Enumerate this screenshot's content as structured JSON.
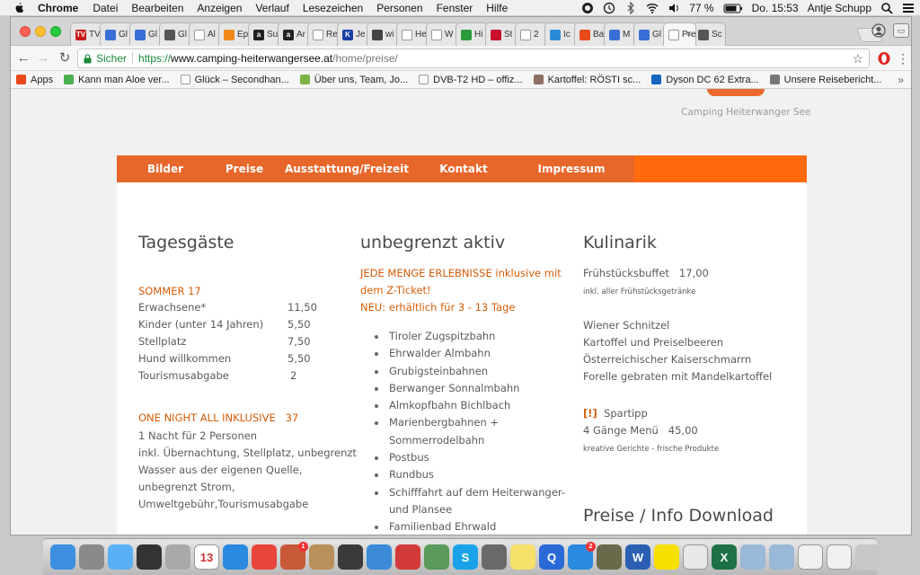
{
  "menubar": {
    "app_name": "Chrome",
    "items": [
      "Datei",
      "Bearbeiten",
      "Anzeigen",
      "Verlauf",
      "Lesezeichen",
      "Personen",
      "Fenster",
      "Hilfe"
    ],
    "battery": "77 %",
    "clock": "Do. 15:53",
    "user": "Antje Schupp"
  },
  "tabs": [
    {
      "label": "TV",
      "color": "#c61c1c",
      "glyph": "TV"
    },
    {
      "label": "Gl",
      "color": "#3a6fd8",
      "glyph": ""
    },
    {
      "label": "Gl",
      "color": "#3a6fd8",
      "glyph": ""
    },
    {
      "label": "Gl",
      "color": "#555555",
      "glyph": ""
    },
    {
      "label": "Al",
      "color": "#ffffff",
      "glyph": ""
    },
    {
      "label": "Ep",
      "color": "#f08a1c",
      "glyph": ""
    },
    {
      "label": "Su",
      "color": "#222222",
      "glyph": "a"
    },
    {
      "label": "Ar",
      "color": "#222222",
      "glyph": "a"
    },
    {
      "label": "Re",
      "color": "#ffffff",
      "glyph": ""
    },
    {
      "label": "Je",
      "color": "#1a3fa6",
      "glyph": "K"
    },
    {
      "label": "wi",
      "color": "#444444",
      "glyph": ""
    },
    {
      "label": "He",
      "color": "#ffffff",
      "glyph": ""
    },
    {
      "label": "W",
      "color": "#ffffff",
      "glyph": ""
    },
    {
      "label": "Hi",
      "color": "#2a9a3a",
      "glyph": ""
    },
    {
      "label": "St",
      "color": "#c8102e",
      "glyph": ""
    },
    {
      "label": "2",
      "color": "#ffffff",
      "glyph": ""
    },
    {
      "label": "Ic",
      "color": "#2a8bd8",
      "glyph": ""
    },
    {
      "label": "Ba",
      "color": "#e84a1c",
      "glyph": ""
    },
    {
      "label": "M",
      "color": "#3a6fd8",
      "glyph": ""
    },
    {
      "label": "Gl",
      "color": "#3a6fd8",
      "glyph": ""
    },
    {
      "label": "Pre",
      "color": "#ffffff",
      "glyph": "",
      "active": true
    },
    {
      "label": "Sc",
      "color": "#555555",
      "glyph": ""
    }
  ],
  "toolbar": {
    "secure_label": "Sicher",
    "url_scheme": "https://",
    "url_host": "www.camping-heiterwangersee.at",
    "url_path": "/home/preise/"
  },
  "bookmarks": [
    {
      "label": "Apps",
      "icon": "apps-icon",
      "color": "#e84a1c"
    },
    {
      "label": "Kann man Aloe ver...",
      "icon": "leaf-icon",
      "color": "#4caf50"
    },
    {
      "label": "Glück – Secondhan...",
      "icon": "page-icon",
      "color": "#ffffff"
    },
    {
      "label": "Über uns, Team, Jo...",
      "icon": "plus-icon",
      "color": "#7cb342"
    },
    {
      "label": "DVB-T2 HD – offiz...",
      "icon": "page-icon",
      "color": "#ffffff"
    },
    {
      "label": "Kartoffel: RÖSTI sc...",
      "icon": "fork-icon",
      "color": "#8d6e63"
    },
    {
      "label": "Dyson DC 62 Extra...",
      "icon": "h-icon",
      "color": "#1565c0"
    },
    {
      "label": "Unsere Reisebericht...",
      "icon": "car-icon",
      "color": "#777777"
    }
  ],
  "site": {
    "tagline": "Camping Heiterwanger See",
    "nav": [
      "Bilder",
      "Preise",
      "Ausstattung/Freizeit",
      "Kontakt",
      "Impressum"
    ]
  },
  "col1": {
    "title": "Tagesgäste",
    "season": "SOMMER 17",
    "prices": [
      {
        "label": "Erwachsene*",
        "value": "11,50"
      },
      {
        "label": "Kinder  (unter 14 Jahren)",
        "value": "5,50"
      },
      {
        "label": "Stellplatz",
        "value": "7,50"
      },
      {
        "label": "Hund willkommen",
        "value": "5,50"
      },
      {
        "label": "Tourismusabgabe",
        "value": "2"
      }
    ],
    "offer_title": "ONE NIGHT ALL INKLUSIVE",
    "offer_price": "37",
    "offer_lines": [
      "1 Nacht für 2 Personen",
      "inkl. Übernachtung, Stellplatz, unbegrenzt",
      "Wasser aus der eigenen Quelle,",
      "unbegrenzt Strom,",
      "Umweltgebühr,Tourismusabgabe"
    ]
  },
  "col2": {
    "title": "unbegrenzt aktiv",
    "highlight_lines": [
      "JEDE MENGE ERLEBNISSE inklusive mit",
      "dem Z-Ticket!",
      "NEU: erhältlich für 3 - 13 Tage"
    ],
    "attractions": [
      "Tiroler Zugspitzbahn",
      "Ehrwalder Almbahn",
      "Grubigsteinbahnen",
      "Berwanger Sonnalmbahn",
      "Almkopfbahn Bichlbach",
      "Marienbergbahnen +",
      "Sommerrodelbahn",
      "Postbus",
      "Rundbus",
      "Schifffahrt auf dem Heiterwanger-",
      "und Plansee",
      "Familienbad Ehrwald"
    ]
  },
  "col3": {
    "title": "Kulinarik",
    "breakfast_label": "Frühstücksbuffet",
    "breakfast_price": "17,00",
    "breakfast_note": "inkl.  aller Frühstücksgetränke",
    "dishes": [
      "Wiener Schnitzel",
      "Kartoffel und Preiselbeeren",
      "Österreichischer Kaiserschmarrn",
      "Forelle gebraten mit Mandelkartoffel"
    ],
    "tip_marker": "[!]",
    "tip_label": "Spartipp",
    "menu_label": "4 Gänge Menü",
    "menu_price": "45,00",
    "menu_note": "kreative Gerichte - frische Produkte",
    "download_title": "Preise / Info Download"
  },
  "dock": [
    {
      "name": "finder",
      "color": "#3d8fe0"
    },
    {
      "name": "launchpad",
      "color": "#8a8a8a"
    },
    {
      "name": "messages",
      "color": "#5ab0f5"
    },
    {
      "name": "dvd-player",
      "color": "#333333"
    },
    {
      "name": "calculator",
      "color": "#a9a9a9"
    },
    {
      "name": "calendar",
      "color": "#ffffff",
      "text": "13"
    },
    {
      "name": "safari",
      "color": "#2a8ae0"
    },
    {
      "name": "chrome",
      "color": "#e8453c"
    },
    {
      "name": "photos-app",
      "color": "#c85a3a",
      "badge": "1"
    },
    {
      "name": "contacts",
      "color": "#b8905a"
    },
    {
      "name": "photo-booth",
      "color": "#3a3a3a"
    },
    {
      "name": "itunes",
      "color": "#3a8ad8"
    },
    {
      "name": "photo-browser",
      "color": "#d23a3a"
    },
    {
      "name": "maps",
      "color": "#5a9a5a"
    },
    {
      "name": "skype",
      "color": "#1aa3e8",
      "text": "S"
    },
    {
      "name": "iphoto",
      "color": "#6a6a6a"
    },
    {
      "name": "stickies",
      "color": "#f5e06a"
    },
    {
      "name": "quicktime",
      "color": "#2a6ad8",
      "text": "Q"
    },
    {
      "name": "app-store",
      "color": "#2a8ae0",
      "badge": "2"
    },
    {
      "name": "utility",
      "color": "#6a6a4a"
    },
    {
      "name": "word",
      "color": "#2b5fb4",
      "text": "W"
    },
    {
      "name": "lidl",
      "color": "#f5e000"
    },
    {
      "name": "gadget",
      "color": "#e8e8e8"
    },
    {
      "name": "excel",
      "color": "#1e7145",
      "text": "X"
    },
    {
      "name": "folder-1",
      "color": "#9ab8d8"
    },
    {
      "name": "folder-2",
      "color": "#9ab8d8"
    },
    {
      "name": "document-1",
      "color": "#f0f0f0"
    },
    {
      "name": "document-2",
      "color": "#f0f0f0"
    },
    {
      "name": "trash",
      "color": "#c8c8c8"
    }
  ]
}
